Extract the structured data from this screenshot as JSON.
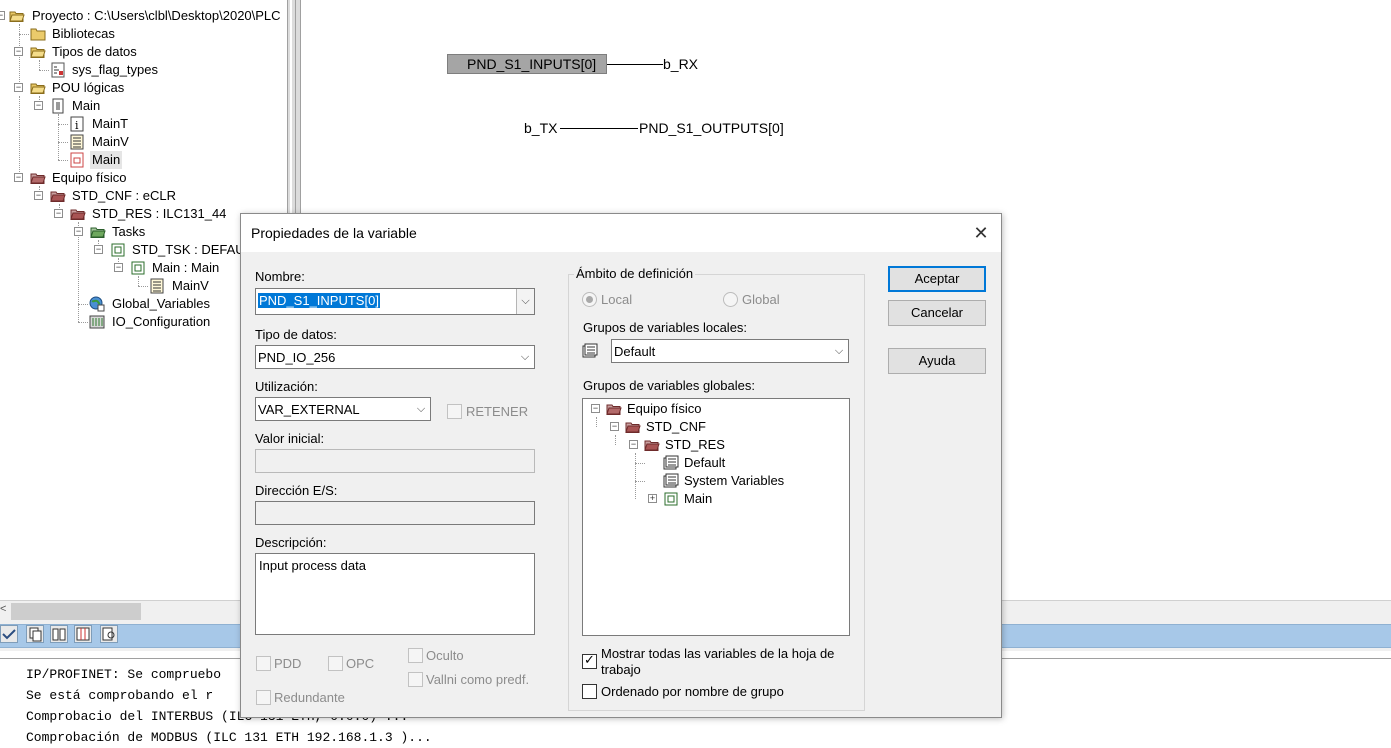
{
  "project_tree": {
    "items": [
      {
        "label": "Proyecto : C:\\Users\\clbl\\Desktop\\2020\\PLC",
        "icon": "folder-open-icon"
      },
      {
        "label": "Bibliotecas",
        "icon": "folder-icon"
      },
      {
        "label": "Tipos de datos",
        "icon": "folder-open-icon"
      },
      {
        "label": "sys_flag_types",
        "icon": "datatype-icon"
      },
      {
        "label": "POU lógicas",
        "icon": "folder-open-icon"
      },
      {
        "label": "Main",
        "icon": "pou-icon"
      },
      {
        "label": "MainT",
        "icon": "info-icon"
      },
      {
        "label": "MainV",
        "icon": "variables-sheet-icon"
      },
      {
        "label": "Main",
        "icon": "code-sheet-icon"
      },
      {
        "label": "Equipo físico",
        "icon": "hardware-folder-icon"
      },
      {
        "label": "STD_CNF : eCLR",
        "icon": "configuration-icon"
      },
      {
        "label": "STD_RES : ILC131_44",
        "icon": "resource-icon"
      },
      {
        "label": "Tasks",
        "icon": "tasks-folder-icon"
      },
      {
        "label": "STD_TSK : DEFAU",
        "icon": "task-icon"
      },
      {
        "label": "Main : Main",
        "icon": "program-instance-icon"
      },
      {
        "label": "MainV",
        "icon": "variables-sheet-icon"
      },
      {
        "label": "Global_Variables",
        "icon": "global-variables-icon"
      },
      {
        "label": "IO_Configuration",
        "icon": "io-config-icon"
      }
    ]
  },
  "diagram": {
    "input_variable": "PND_S1_INPUTS[0]",
    "input_target": "b_RX",
    "output_source": "b_TX",
    "output_variable": "PND_S1_OUTPUTS[0]"
  },
  "messages": {
    "lines": [
      "IP/PROFINET: Se compruebо",
      "Se está comprobando el r",
      "Comprobacio del INTERBUS (ILC 131 ETH, 0.0.0) ...",
      "Comprobación de MODBUS (ILC 131 ETH 192.168.1.3 )..."
    ]
  },
  "dialog": {
    "title": "Propiedades de la variable",
    "name_label": "Nombre:",
    "name_value": "PND_S1_INPUTS[0]",
    "datatype_label": "Tipo de datos:",
    "datatype_value": "PND_IO_256",
    "usage_label": "Utilización:",
    "usage_value": "VAR_EXTERNAL",
    "retain_label": "RETENER",
    "initial_value_label": "Valor inicial:",
    "io_address_label": "Dirección E/S:",
    "description_label": "Descripción:",
    "description_value": "Input process data",
    "pdd_label": "PDD",
    "opc_label": "OPC",
    "hidden_label": "Oculto",
    "redundant_label": "Redundante",
    "default_init_label": "Vallni como predf.",
    "scope_group_title": "Ámbito de definición",
    "scope_local_label": "Local",
    "scope_global_label": "Global",
    "local_groups_label": "Grupos de variables locales:",
    "local_group_value": "Default",
    "global_groups_label": "Grupos de variables globales:",
    "global_tree": [
      {
        "label": "Equipo físico",
        "icon": "hardware-folder-icon"
      },
      {
        "label": "STD_CNF",
        "icon": "configuration-icon"
      },
      {
        "label": "STD_RES",
        "icon": "resource-icon"
      },
      {
        "label": "Default",
        "icon": "variable-group-icon"
      },
      {
        "label": "System Variables",
        "icon": "variable-group-icon"
      },
      {
        "label": "Main",
        "icon": "program-instance-icon"
      }
    ],
    "show_all_label_line1": "Mostrar todas las variables de la hoja de",
    "show_all_label_line2": "trabajo",
    "show_all_checked": true,
    "sort_by_group_label": "Ordenado por nombre de grupo",
    "sort_by_group_checked": false,
    "ok_label": "Aceptar",
    "cancel_label": "Cancelar",
    "help_label": "Ayuda",
    "close_glyph": "✕"
  }
}
